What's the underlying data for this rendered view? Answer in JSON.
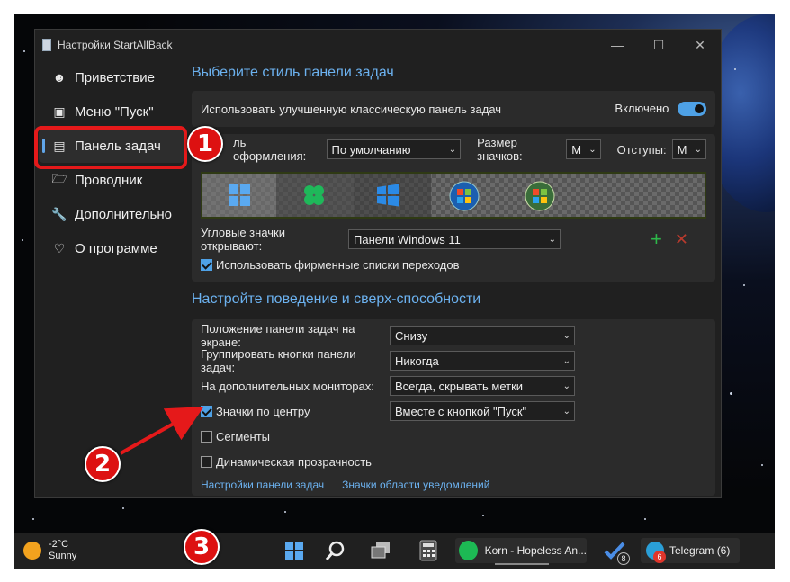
{
  "window": {
    "title": "Настройки StartAllBack"
  },
  "sidebar": {
    "items": [
      {
        "label": "Приветствие"
      },
      {
        "label": "Меню \"Пуск\""
      },
      {
        "label": "Панель задач"
      },
      {
        "label": "Проводник"
      },
      {
        "label": "Дополнительно"
      },
      {
        "label": "О программе"
      }
    ]
  },
  "section1": {
    "title": "Выберите стиль панели задач",
    "enhanced_label": "Использовать улучшенную классическую панель задач",
    "enhanced_state": "Включено",
    "style_label": "ль оформления:",
    "style_value": "По умолчанию",
    "icon_size_label": "Размер значков:",
    "icon_size_value": "M",
    "margins_label": "Отступы:",
    "margins_value": "M",
    "corner_label": "Угловые значки открывают:",
    "corner_value": "Панели Windows 11",
    "jumplists_label": "Использовать фирменные списки переходов"
  },
  "section2": {
    "title": "Настройте поведение и сверх-способности",
    "position_label": "Положение панели задач на экране:",
    "position_value": "Снизу",
    "group_label": "Группировать кнопки панели задач:",
    "group_value": "Никогда",
    "monitors_label": "На дополнительных мониторах:",
    "monitors_value": "Всегда, скрывать метки",
    "center_label": "Значки по центру",
    "center_value": "Вместе с кнопкой \"Пуск\"",
    "segments_label": "Сегменты",
    "dyn_label": "Динамическая прозрачность",
    "link1": "Настройки панели задач",
    "link2": "Значки области уведомлений"
  },
  "taskbar": {
    "weather_temp": "-2°C",
    "weather_text": "Sunny",
    "spotify_label": "Korn - Hopeless An...",
    "todo_badge": "8",
    "telegram_label": "Telegram (6)",
    "telegram_badge": "6"
  },
  "callouts": [
    "1",
    "2",
    "3"
  ],
  "colors": {
    "accent": "#4ea1e6",
    "heading": "#6cb2f0",
    "callout": "#dd1111"
  }
}
